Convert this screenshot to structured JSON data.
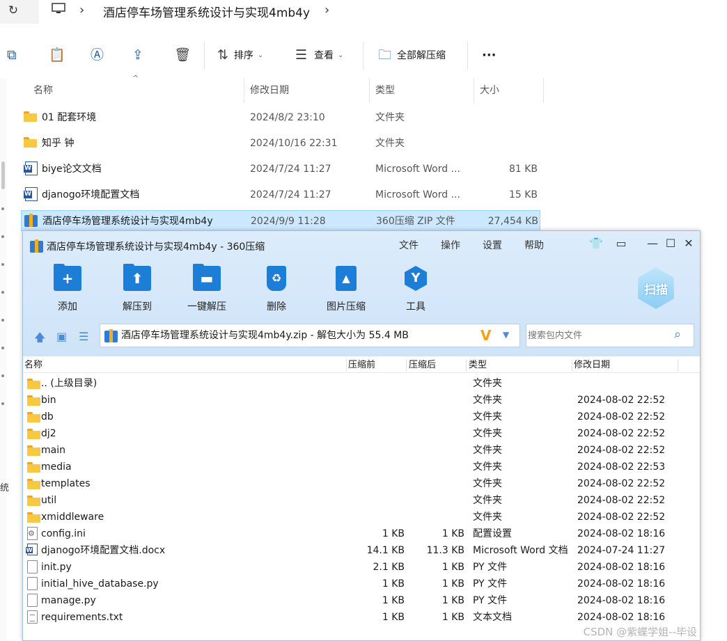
{
  "explorer": {
    "breadcrumb": "酒店停车场管理系统设计与实现4mb4y",
    "toolbar": {
      "sort_label": "排序",
      "view_label": "查看",
      "extract_all_label": "全部解压缩",
      "more_label": "···"
    },
    "columns": {
      "name": "名称",
      "date": "修改日期",
      "type": "类型",
      "size": "大小"
    },
    "files": [
      {
        "icon": "folder-icon",
        "name": "01 配套环境",
        "date": "2024/8/2 23:10",
        "type": "文件夹",
        "size": ""
      },
      {
        "icon": "folder-icon",
        "name": "知乎 钟",
        "date": "2024/10/16 22:31",
        "type": "文件夹",
        "size": ""
      },
      {
        "icon": "word-doc-icon",
        "name": "biye论文文档",
        "date": "2024/7/24 11:27",
        "type": "Microsoft Word ...",
        "size": "81 KB"
      },
      {
        "icon": "word-doc-icon",
        "name": "djanogo环境配置文档",
        "date": "2024/7/24 11:27",
        "type": "Microsoft Word ...",
        "size": "15 KB"
      },
      {
        "icon": "zip-archive-icon",
        "name": "酒店停车场管理系统设计与实现4mb4y",
        "date": "2024/9/9 11:28",
        "type": "360压缩 ZIP 文件",
        "size": "27,454 KB"
      }
    ],
    "side_char": "统"
  },
  "zip_window": {
    "title": "酒店停车场管理系统设计与实现4mb4y - 360压缩",
    "menu": [
      "文件",
      "操作",
      "设置",
      "帮助"
    ],
    "tools": [
      {
        "label": "添加",
        "icon": "add-icon"
      },
      {
        "label": "解压到",
        "icon": "extract-to-icon"
      },
      {
        "label": "一键解压",
        "icon": "one-click-extract-icon"
      },
      {
        "label": "删除",
        "icon": "delete-icon"
      },
      {
        "label": "图片压缩",
        "icon": "image-compress-icon"
      },
      {
        "label": "工具",
        "icon": "tools-icon"
      }
    ],
    "scan_label": "扫描",
    "path": "酒店停车场管理系统设计与实现4mb4y.zip - 解包大小为 55.4 MB",
    "search_placeholder": "搜索包内文件",
    "columns": {
      "name": "名称",
      "before": "压缩前",
      "after": "压缩后",
      "type": "类型",
      "date": "修改日期"
    },
    "entries": [
      {
        "icon": "folder-icon",
        "name": ".. (上级目录)",
        "before": "",
        "after": "",
        "type": "文件夹",
        "date": ""
      },
      {
        "icon": "folder-icon",
        "name": "bin",
        "before": "",
        "after": "",
        "type": "文件夹",
        "date": "2024-08-02 22:52"
      },
      {
        "icon": "folder-icon",
        "name": "db",
        "before": "",
        "after": "",
        "type": "文件夹",
        "date": "2024-08-02 22:52"
      },
      {
        "icon": "folder-icon",
        "name": "dj2",
        "before": "",
        "after": "",
        "type": "文件夹",
        "date": "2024-08-02 22:52"
      },
      {
        "icon": "folder-icon",
        "name": "main",
        "before": "",
        "after": "",
        "type": "文件夹",
        "date": "2024-08-02 22:52"
      },
      {
        "icon": "folder-icon",
        "name": "media",
        "before": "",
        "after": "",
        "type": "文件夹",
        "date": "2024-08-02 22:53"
      },
      {
        "icon": "folder-icon",
        "name": "templates",
        "before": "",
        "after": "",
        "type": "文件夹",
        "date": "2024-08-02 22:52"
      },
      {
        "icon": "folder-icon",
        "name": "util",
        "before": "",
        "after": "",
        "type": "文件夹",
        "date": "2024-08-02 22:52"
      },
      {
        "icon": "folder-icon",
        "name": "xmiddleware",
        "before": "",
        "after": "",
        "type": "文件夹",
        "date": "2024-08-02 22:52"
      },
      {
        "icon": "config-file-icon",
        "name": "config.ini",
        "before": "1 KB",
        "after": "1 KB",
        "type": "配置设置",
        "date": "2024-08-02 18:16"
      },
      {
        "icon": "word-doc-icon",
        "name": "djanogo环境配置文档.docx",
        "before": "14.1 KB",
        "after": "11.3 KB",
        "type": "Microsoft Word 文档",
        "date": "2024-07-24 11:27"
      },
      {
        "icon": "file-icon",
        "name": "init.py",
        "before": "2.1 KB",
        "after": "1 KB",
        "type": "PY 文件",
        "date": "2024-08-02 18:16"
      },
      {
        "icon": "file-icon",
        "name": "initial_hive_database.py",
        "before": "1 KB",
        "after": "1 KB",
        "type": "PY 文件",
        "date": "2024-08-02 18:16"
      },
      {
        "icon": "file-icon",
        "name": "manage.py",
        "before": "1 KB",
        "after": "1 KB",
        "type": "PY 文件",
        "date": "2024-08-02 18:16"
      },
      {
        "icon": "text-file-icon",
        "name": "requirements.txt",
        "before": "1 KB",
        "after": "1 KB",
        "type": "文本文档",
        "date": "2024-08-02 18:16"
      }
    ]
  },
  "watermark": "CSDN @紫蝶学姐--毕设"
}
